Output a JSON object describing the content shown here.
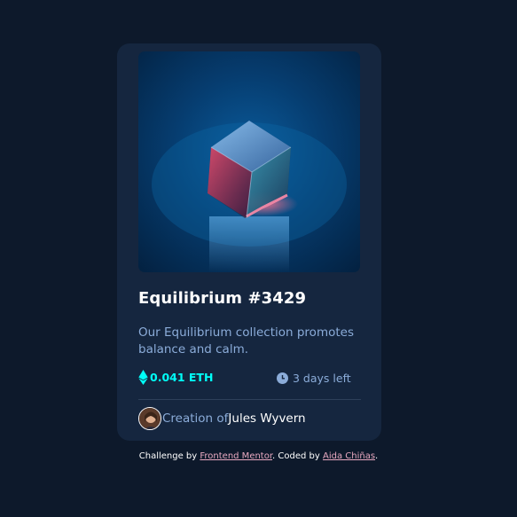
{
  "card": {
    "image_alt": "Equilibrium cube artwork",
    "title": "Equilibrium #3429",
    "description": "Our Equilibrium collection promotes balance and calm.",
    "price": "0.041 ETH",
    "price_icon": "ethereum-icon",
    "time_left": "3 days left",
    "time_icon": "clock-icon",
    "creator_prefix": "Creation of",
    "creator_name": "Jules Wyvern"
  },
  "attribution": {
    "prefix": "Challenge by ",
    "link1": "Frontend Mentor",
    "middle": ". Coded by ",
    "link2": "Aida Chiñas",
    "suffix": "."
  },
  "colors": {
    "page_background": "#0d192b",
    "card_background": "#15263f",
    "accent_cyan": "#00fff8",
    "soft_blue": "#8bacd9",
    "link_pink": "#e8a9c0"
  }
}
